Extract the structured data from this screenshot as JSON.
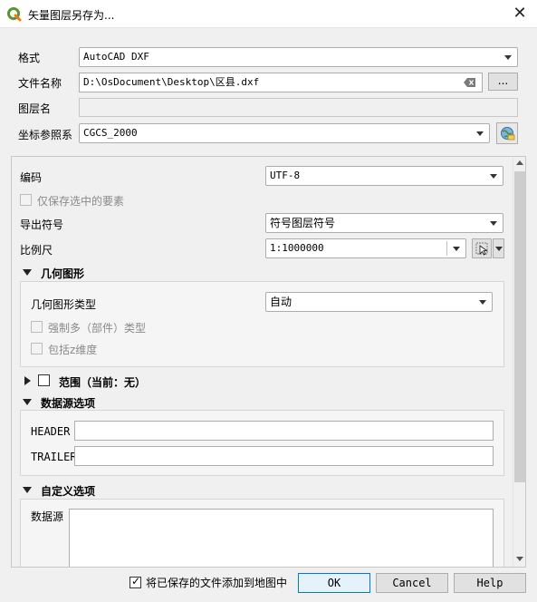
{
  "window": {
    "title": "矢量图层另存为...",
    "close_glyph": "✕"
  },
  "form": {
    "format_label": "格式",
    "format_value": "AutoCAD DXF",
    "filename_label": "文件名称",
    "filename_value": "D:\\OsDocument\\Desktop\\区县.dxf",
    "browse_label": "...",
    "layername_label": "图层名",
    "layername_value": "",
    "crs_label": "坐标参照系",
    "crs_value": "CGCS_2000"
  },
  "options": {
    "encoding_label": "编码",
    "encoding_value": "UTF-8",
    "selected_only_label": "仅保存选中的要素",
    "symbology_label": "导出符号",
    "symbology_value": "符号图层符号",
    "scale_label": "比例尺",
    "scale_value": "1:1000000"
  },
  "geometry": {
    "title": "几何图形",
    "type_label": "几何图形类型",
    "type_value": "自动",
    "force_multi_label": "强制多（部件）类型",
    "include_z_label": "包括z维度"
  },
  "extent": {
    "title": "范围（当前：无）"
  },
  "datasource": {
    "title": "数据源选项",
    "header_label": "HEADER",
    "header_value": "",
    "trailer_label": "TRAILER",
    "trailer_value": ""
  },
  "custom": {
    "title": "自定义选项",
    "datasource_label": "数据源"
  },
  "footer": {
    "add_to_map_label": "将已保存的文件添加到地图中",
    "ok_label": "OK",
    "cancel_label": "Cancel",
    "help_label": "Help"
  },
  "colors": {
    "accent": "#0078d7",
    "qgis_green": "#589632",
    "qgis_yellow": "#ee7913"
  }
}
